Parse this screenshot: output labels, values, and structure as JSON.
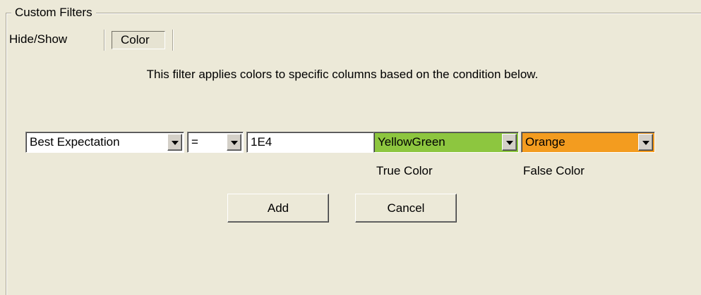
{
  "group": {
    "title": "Custom Filters"
  },
  "tabs": [
    {
      "label": "Hide/Show",
      "selected": false
    },
    {
      "label": "Color",
      "selected": true
    }
  ],
  "description": "This filter applies colors to specific columns based on the condition below.",
  "condition": {
    "column": "Best Expectation",
    "operator": "=",
    "value": "1E4",
    "true_color": "YellowGreen",
    "false_color": "Orange",
    "true_color_swatch": "#8dc63f",
    "false_color_swatch": "#f39c1f"
  },
  "labels": {
    "true_color": "True Color",
    "false_color": "False Color"
  },
  "buttons": {
    "add": "Add",
    "cancel": "Cancel"
  },
  "icons": {
    "dropdown": "chevron-down-icon"
  }
}
